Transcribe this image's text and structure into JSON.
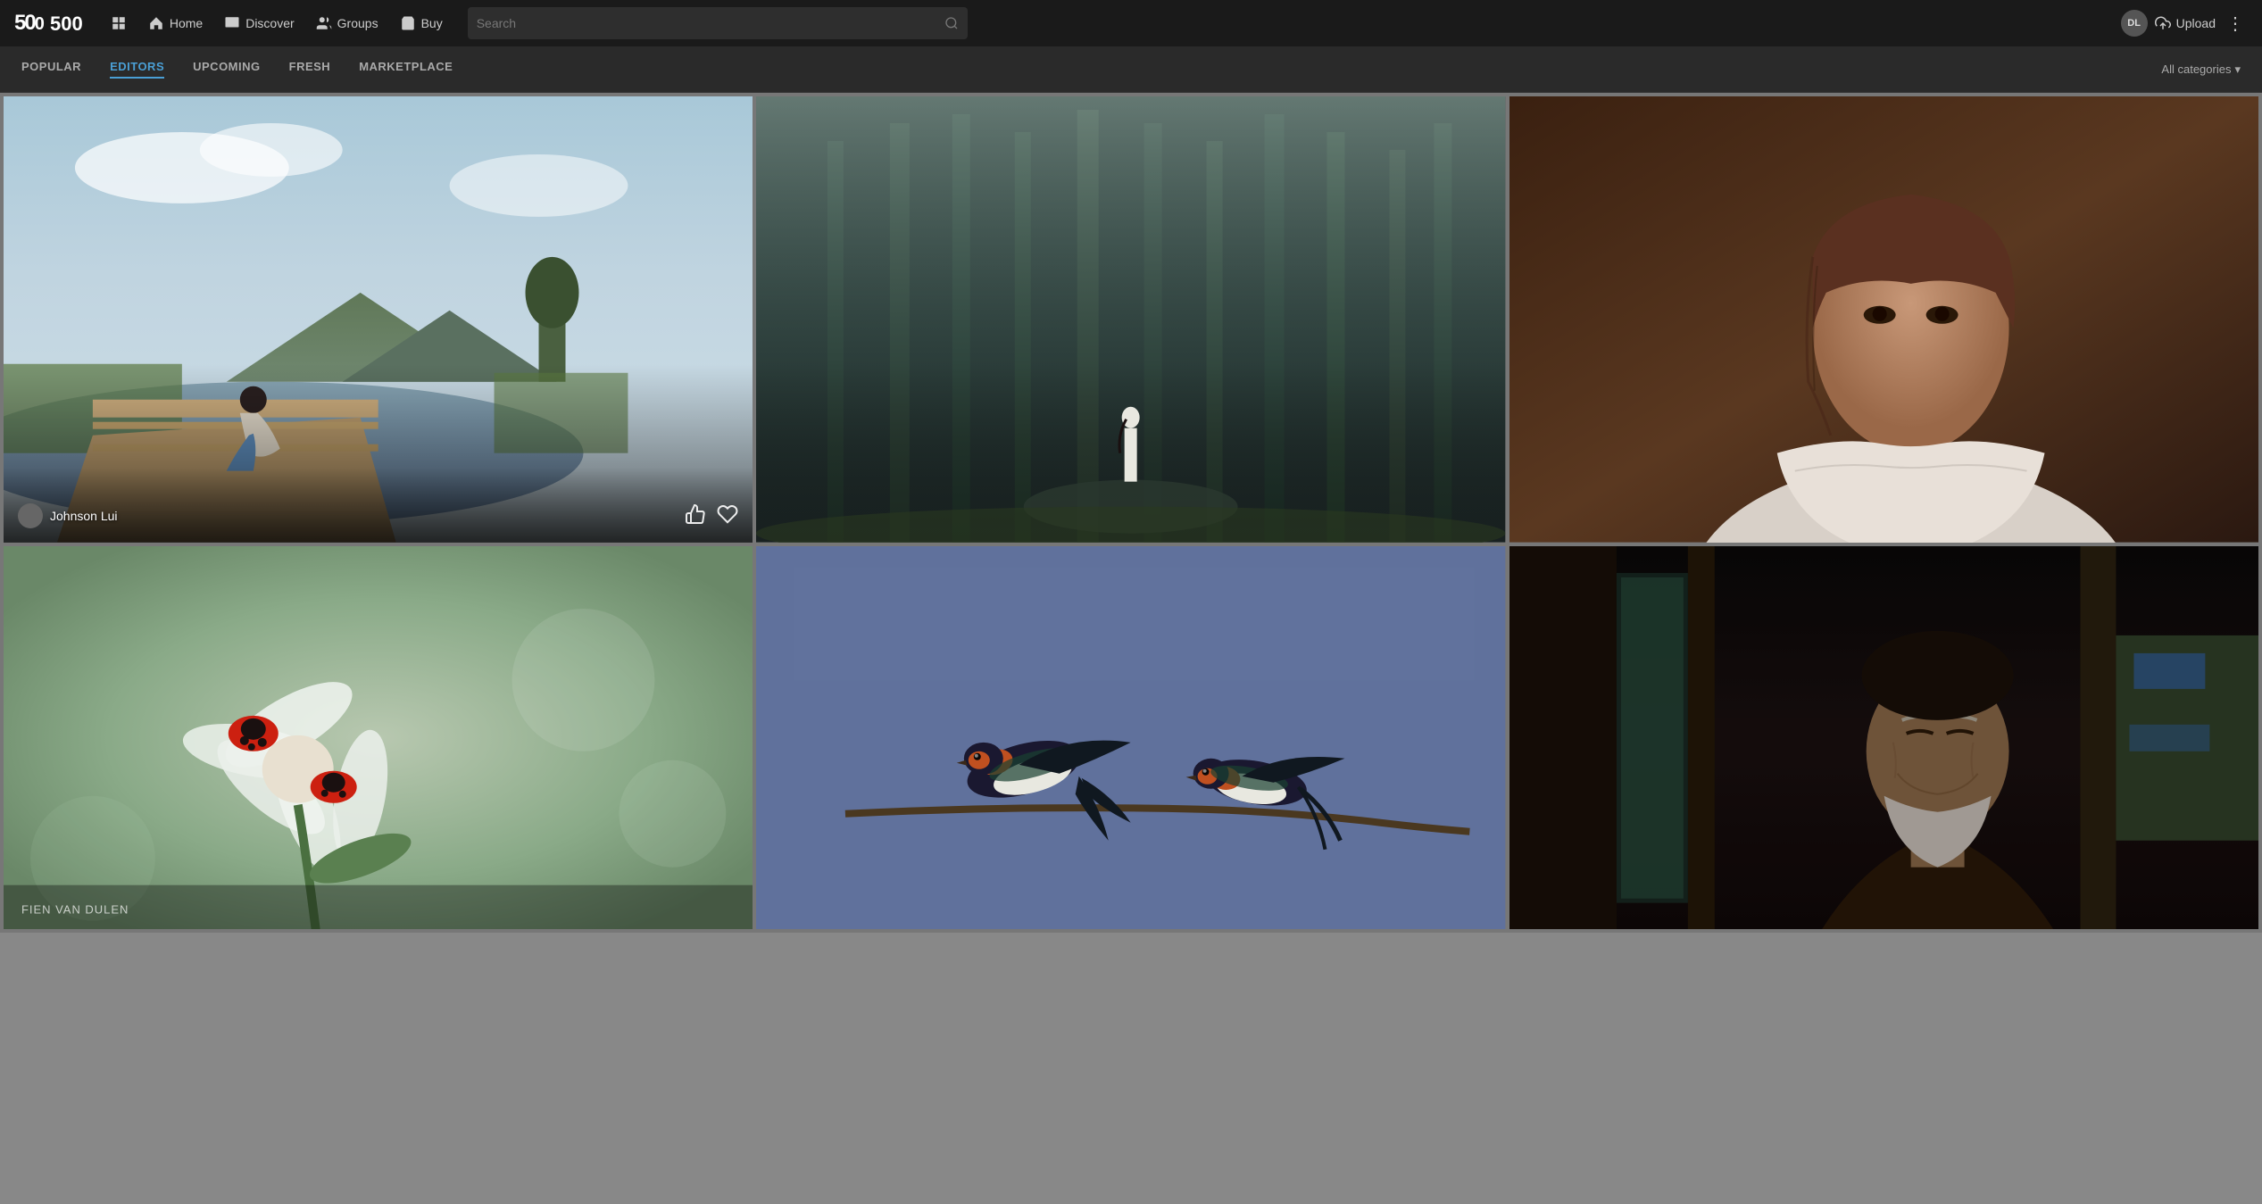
{
  "app": {
    "logo": "500",
    "logo_icon": "≡"
  },
  "navbar": {
    "home_label": "Home",
    "discover_label": "Discover",
    "groups_label": "Groups",
    "buy_label": "Buy",
    "upload_label": "Upload",
    "user_initials": "DL",
    "search_placeholder": "Search"
  },
  "subnav": {
    "tabs": [
      {
        "id": "popular",
        "label": "POPULAR",
        "active": false
      },
      {
        "id": "editors",
        "label": "EDITORS",
        "active": true
      },
      {
        "id": "upcoming",
        "label": "UPCOMING",
        "active": false
      },
      {
        "id": "fresh",
        "label": "FRESH",
        "active": false
      },
      {
        "id": "marketplace",
        "label": "MARKETPLACE",
        "active": false
      }
    ],
    "categories_label": "All categories",
    "categories_arrow": "▾"
  },
  "photos": [
    {
      "id": 1,
      "author": "Johnson Lui",
      "row": 1,
      "col": 1,
      "bg_class": "photo-bg-1",
      "show_overlay": true
    },
    {
      "id": 2,
      "author": "",
      "row": 1,
      "col": 2,
      "bg_class": "photo-bg-2",
      "show_overlay": false
    },
    {
      "id": 3,
      "author": "",
      "row": 1,
      "col": 3,
      "bg_class": "photo-bg-3",
      "show_overlay": false
    },
    {
      "id": 4,
      "author": "FIEN VAN DULEN",
      "row": 2,
      "col": 1,
      "bg_class": "photo-bg-4",
      "show_overlay": false
    },
    {
      "id": 5,
      "author": "",
      "row": 2,
      "col": 2,
      "bg_class": "photo-bg-5",
      "show_overlay": false
    },
    {
      "id": 6,
      "author": "",
      "row": 2,
      "col": 3,
      "bg_class": "photo-bg-6",
      "show_overlay": false
    }
  ],
  "icons": {
    "like": "👍",
    "heart": "♡",
    "search": "🔍",
    "more": "⋮"
  }
}
